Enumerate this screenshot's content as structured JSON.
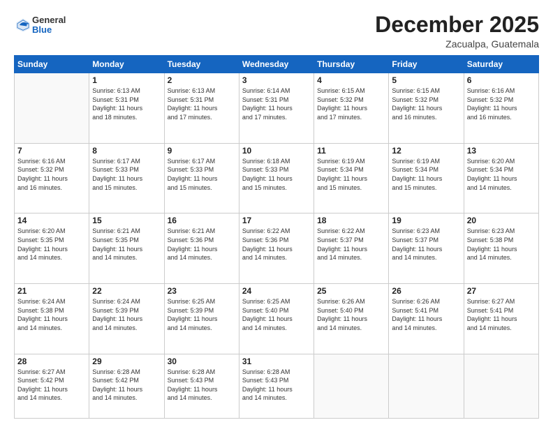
{
  "header": {
    "logo": {
      "general": "General",
      "blue": "Blue"
    },
    "title": "December 2025",
    "subtitle": "Zacualpa, Guatemala"
  },
  "days_of_week": [
    "Sunday",
    "Monday",
    "Tuesday",
    "Wednesday",
    "Thursday",
    "Friday",
    "Saturday"
  ],
  "weeks": [
    [
      {
        "day": "",
        "info": ""
      },
      {
        "day": "1",
        "info": "Sunrise: 6:13 AM\nSunset: 5:31 PM\nDaylight: 11 hours\nand 18 minutes."
      },
      {
        "day": "2",
        "info": "Sunrise: 6:13 AM\nSunset: 5:31 PM\nDaylight: 11 hours\nand 17 minutes."
      },
      {
        "day": "3",
        "info": "Sunrise: 6:14 AM\nSunset: 5:31 PM\nDaylight: 11 hours\nand 17 minutes."
      },
      {
        "day": "4",
        "info": "Sunrise: 6:15 AM\nSunset: 5:32 PM\nDaylight: 11 hours\nand 17 minutes."
      },
      {
        "day": "5",
        "info": "Sunrise: 6:15 AM\nSunset: 5:32 PM\nDaylight: 11 hours\nand 16 minutes."
      },
      {
        "day": "6",
        "info": "Sunrise: 6:16 AM\nSunset: 5:32 PM\nDaylight: 11 hours\nand 16 minutes."
      }
    ],
    [
      {
        "day": "7",
        "info": "Sunrise: 6:16 AM\nSunset: 5:32 PM\nDaylight: 11 hours\nand 16 minutes."
      },
      {
        "day": "8",
        "info": "Sunrise: 6:17 AM\nSunset: 5:33 PM\nDaylight: 11 hours\nand 15 minutes."
      },
      {
        "day": "9",
        "info": "Sunrise: 6:17 AM\nSunset: 5:33 PM\nDaylight: 11 hours\nand 15 minutes."
      },
      {
        "day": "10",
        "info": "Sunrise: 6:18 AM\nSunset: 5:33 PM\nDaylight: 11 hours\nand 15 minutes."
      },
      {
        "day": "11",
        "info": "Sunrise: 6:19 AM\nSunset: 5:34 PM\nDaylight: 11 hours\nand 15 minutes."
      },
      {
        "day": "12",
        "info": "Sunrise: 6:19 AM\nSunset: 5:34 PM\nDaylight: 11 hours\nand 15 minutes."
      },
      {
        "day": "13",
        "info": "Sunrise: 6:20 AM\nSunset: 5:34 PM\nDaylight: 11 hours\nand 14 minutes."
      }
    ],
    [
      {
        "day": "14",
        "info": "Sunrise: 6:20 AM\nSunset: 5:35 PM\nDaylight: 11 hours\nand 14 minutes."
      },
      {
        "day": "15",
        "info": "Sunrise: 6:21 AM\nSunset: 5:35 PM\nDaylight: 11 hours\nand 14 minutes."
      },
      {
        "day": "16",
        "info": "Sunrise: 6:21 AM\nSunset: 5:36 PM\nDaylight: 11 hours\nand 14 minutes."
      },
      {
        "day": "17",
        "info": "Sunrise: 6:22 AM\nSunset: 5:36 PM\nDaylight: 11 hours\nand 14 minutes."
      },
      {
        "day": "18",
        "info": "Sunrise: 6:22 AM\nSunset: 5:37 PM\nDaylight: 11 hours\nand 14 minutes."
      },
      {
        "day": "19",
        "info": "Sunrise: 6:23 AM\nSunset: 5:37 PM\nDaylight: 11 hours\nand 14 minutes."
      },
      {
        "day": "20",
        "info": "Sunrise: 6:23 AM\nSunset: 5:38 PM\nDaylight: 11 hours\nand 14 minutes."
      }
    ],
    [
      {
        "day": "21",
        "info": "Sunrise: 6:24 AM\nSunset: 5:38 PM\nDaylight: 11 hours\nand 14 minutes."
      },
      {
        "day": "22",
        "info": "Sunrise: 6:24 AM\nSunset: 5:39 PM\nDaylight: 11 hours\nand 14 minutes."
      },
      {
        "day": "23",
        "info": "Sunrise: 6:25 AM\nSunset: 5:39 PM\nDaylight: 11 hours\nand 14 minutes."
      },
      {
        "day": "24",
        "info": "Sunrise: 6:25 AM\nSunset: 5:40 PM\nDaylight: 11 hours\nand 14 minutes."
      },
      {
        "day": "25",
        "info": "Sunrise: 6:26 AM\nSunset: 5:40 PM\nDaylight: 11 hours\nand 14 minutes."
      },
      {
        "day": "26",
        "info": "Sunrise: 6:26 AM\nSunset: 5:41 PM\nDaylight: 11 hours\nand 14 minutes."
      },
      {
        "day": "27",
        "info": "Sunrise: 6:27 AM\nSunset: 5:41 PM\nDaylight: 11 hours\nand 14 minutes."
      }
    ],
    [
      {
        "day": "28",
        "info": "Sunrise: 6:27 AM\nSunset: 5:42 PM\nDaylight: 11 hours\nand 14 minutes."
      },
      {
        "day": "29",
        "info": "Sunrise: 6:28 AM\nSunset: 5:42 PM\nDaylight: 11 hours\nand 14 minutes."
      },
      {
        "day": "30",
        "info": "Sunrise: 6:28 AM\nSunset: 5:43 PM\nDaylight: 11 hours\nand 14 minutes."
      },
      {
        "day": "31",
        "info": "Sunrise: 6:28 AM\nSunset: 5:43 PM\nDaylight: 11 hours\nand 14 minutes."
      },
      {
        "day": "",
        "info": ""
      },
      {
        "day": "",
        "info": ""
      },
      {
        "day": "",
        "info": ""
      }
    ]
  ]
}
